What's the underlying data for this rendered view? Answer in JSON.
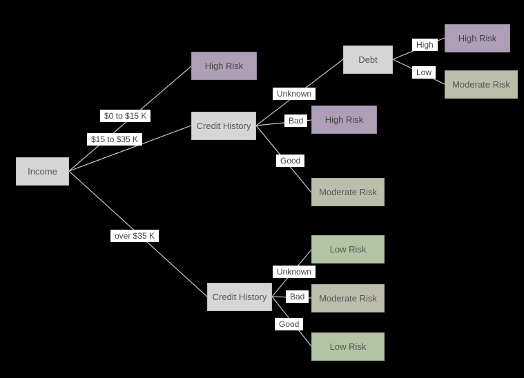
{
  "nodes": {
    "income": "Income",
    "highrisk1": "High Risk",
    "ch1": "Credit History",
    "ch2": "Credit History",
    "debt": "Debt",
    "highrisk2": "High Risk",
    "modrisk1": "Moderate Risk",
    "highrisk3": "High Risk",
    "modrisk2": "Moderate Risk",
    "lowrisk1": "Low Risk",
    "modrisk3": "Moderate Risk",
    "lowrisk2": "Low Risk"
  },
  "edges": {
    "income_0_15": "$0 to $15 K",
    "income_15_35": "$15 to $35 K",
    "income_over35": "over $35 K",
    "ch1_unknown": "Unknown",
    "ch1_bad": "Bad",
    "ch1_good": "Good",
    "ch2_unknown": "Unknown",
    "ch2_bad": "Bad",
    "ch2_good": "Good",
    "debt_high": "High",
    "debt_low": "Low"
  }
}
